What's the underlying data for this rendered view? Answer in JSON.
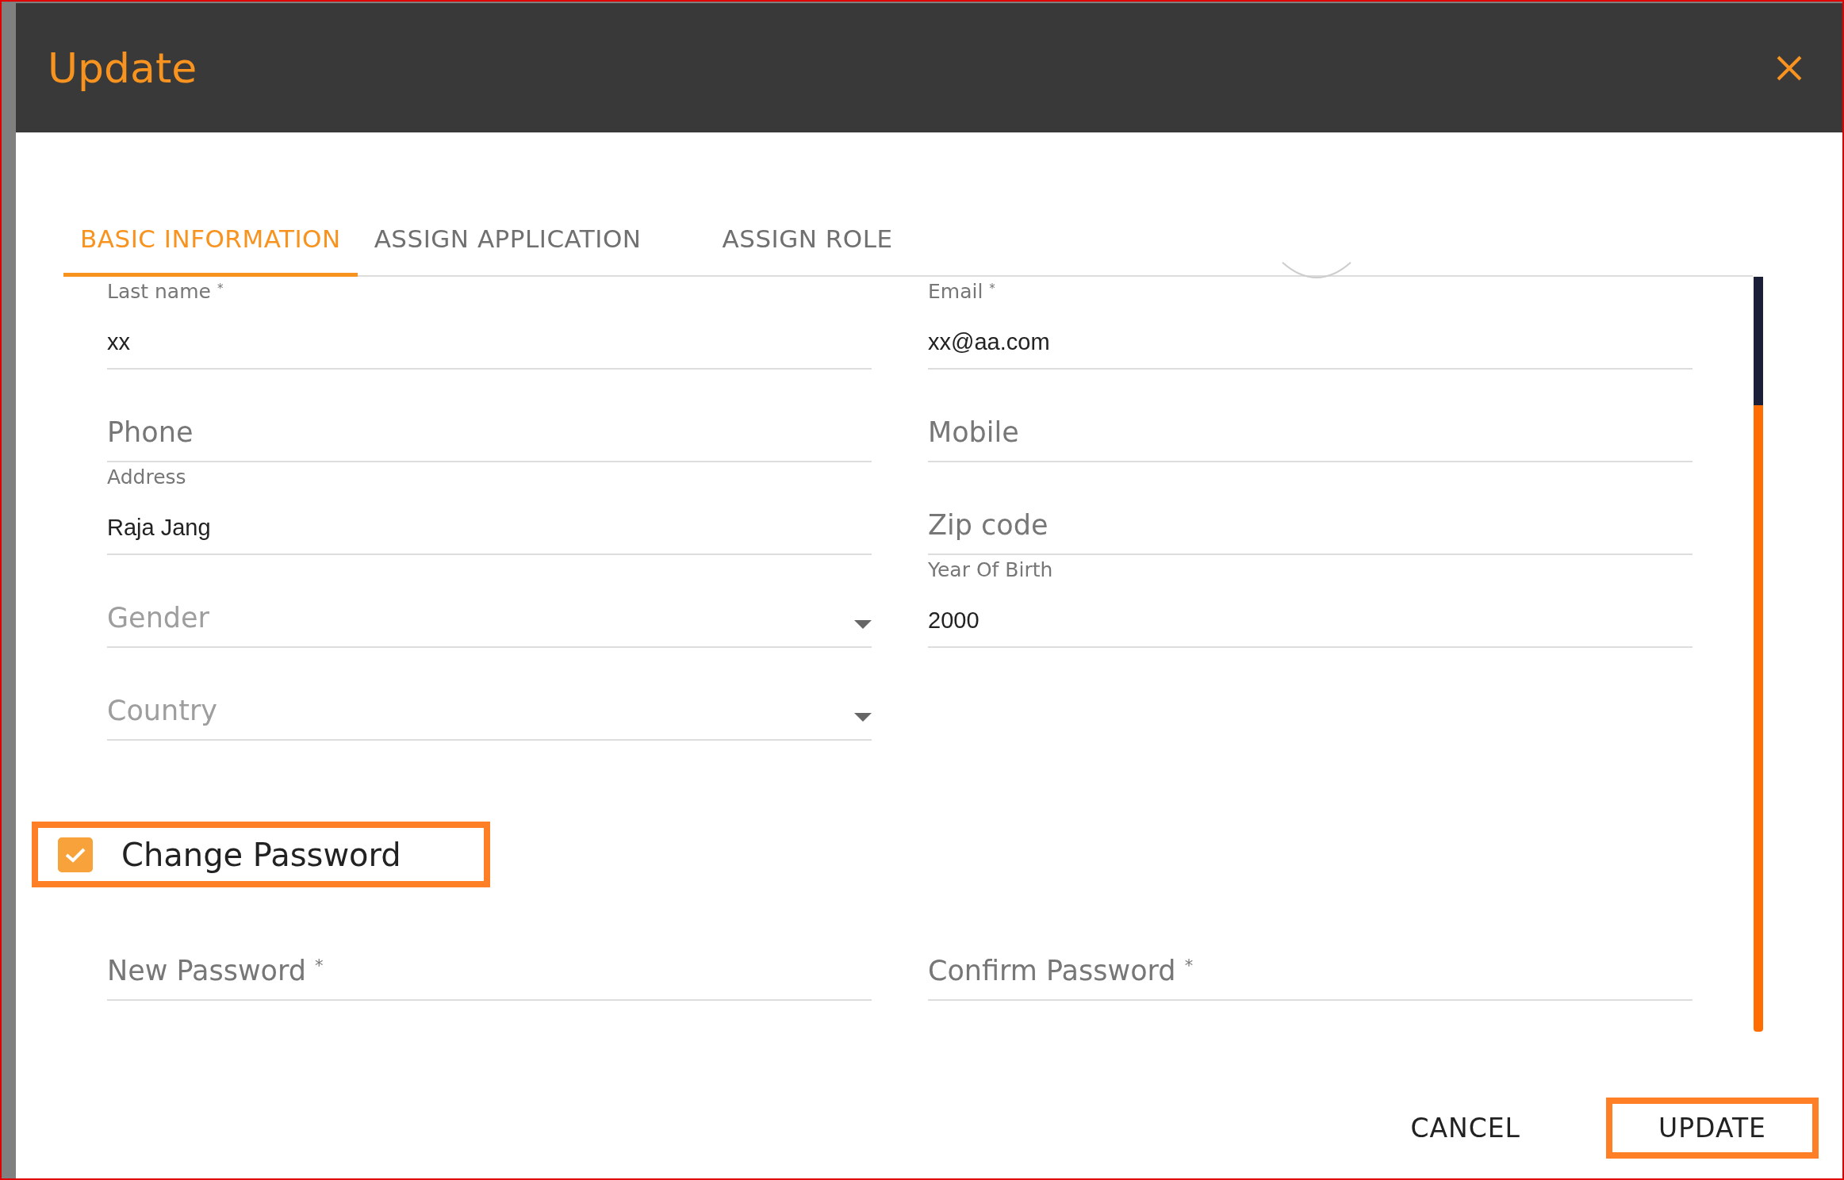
{
  "dialog": {
    "title": "Update"
  },
  "tabs": [
    {
      "label": "BASIC INFORMATION",
      "selected": true
    },
    {
      "label": "ASSIGN APPLICATION",
      "selected": false
    },
    {
      "label": "ASSIGN ROLE",
      "selected": false
    }
  ],
  "field_rows": [
    [
      {
        "label": "Last name $^{*}$",
        "value": "xx",
        "kind": "text"
      },
      {
        "label": "Email $^{*}$",
        "value": "xx@aa.com",
        "kind": "text"
      }
    ],
    [
      {
        "label": "Phone",
        "kind": "text"
      },
      {
        "label": "Mobile",
        "kind": "text"
      }
    ],
    [
      {
        "label": "Address",
        "value": "Raja Jang",
        "kind": "text"
      },
      {
        "label": "Zip code",
        "kind": "text"
      }
    ],
    [
      {
        "label": "Gender",
        "kind": "select"
      },
      {
        "label": "Year Of Birth",
        "value": "2000",
        "kind": "text"
      }
    ],
    [
      {
        "label": "Country",
        "kind": "select"
      }
    ]
  ],
  "change_password": {
    "label": "Change Password",
    "checked": true,
    "highlighted": true
  },
  "password_fields": [
    {
      "label": "New Password $^{*}$"
    },
    {
      "label": "Confirm Password $^{*}$"
    }
  ],
  "buttons": [
    {
      "label": "CANCEL",
      "highlighted": false
    },
    {
      "label": "UPDATE",
      "highlighted": true
    }
  ]
}
